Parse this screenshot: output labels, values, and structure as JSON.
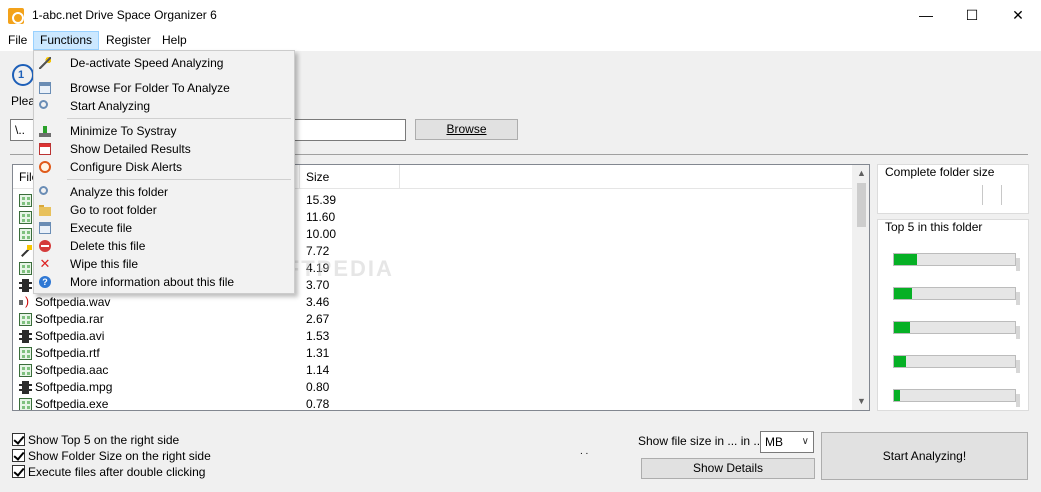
{
  "window": {
    "title": "1-abc.net Drive Space Organizer 6",
    "minimize_glyph": "—",
    "maximize_glyph": "☐",
    "close_glyph": "✕"
  },
  "menubar": {
    "file": "File",
    "functions": "Functions",
    "register": "Register",
    "help": "Help"
  },
  "header": {
    "logo_text": "1",
    "please_text": "Pleas"
  },
  "path": {
    "value": "\\..",
    "browse_label": "Browse"
  },
  "file_list": {
    "columns": [
      "File",
      "Size"
    ],
    "rows": [
      {
        "name": "",
        "size": "15.39",
        "icon": "grid-file-icon"
      },
      {
        "name": "",
        "size": "11.60",
        "icon": "grid-file-icon"
      },
      {
        "name": "",
        "size": "10.00",
        "icon": "grid-file-icon"
      },
      {
        "name": "",
        "size": "7.72",
        "icon": "wand-file-icon"
      },
      {
        "name": "",
        "size": "4.19",
        "icon": "grid-file-icon"
      },
      {
        "name": "",
        "size": "3.70",
        "icon": "film-file-icon"
      },
      {
        "name": "Softpedia.wav",
        "size": "3.46",
        "icon": "sound-file-icon"
      },
      {
        "name": "Softpedia.rar",
        "size": "2.67",
        "icon": "grid-file-icon"
      },
      {
        "name": "Softpedia.avi",
        "size": "1.53",
        "icon": "film-file-icon"
      },
      {
        "name": "Softpedia.rtf",
        "size": "1.31",
        "icon": "grid-file-icon"
      },
      {
        "name": "Softpedia.aac",
        "size": "1.14",
        "icon": "grid-file-icon"
      },
      {
        "name": "Softpedia.mpg",
        "size": "0.80",
        "icon": "film-file-icon"
      },
      {
        "name": "Softpedia.exe",
        "size": "0.78",
        "icon": "grid-file-icon"
      }
    ]
  },
  "side_panel": {
    "complete_folder_size": "Complete folder size",
    "top5_label": "Top 5 in this folder",
    "top5_fill_fractions": [
      0.19,
      0.15,
      0.13,
      0.1,
      0.05
    ]
  },
  "bottom": {
    "checkboxes": [
      {
        "label": "Show Top 5 on the right side",
        "checked": true
      },
      {
        "label": "Show Folder Size on the right side",
        "checked": true
      },
      {
        "label": "Execute files after double clicking",
        "checked": true
      }
    ],
    "size_label": "Show file size in ... in ...",
    "unit_selected": "MB",
    "dots": ". .",
    "show_details": "Show Details",
    "start_analyzing": "Start Analyzing!"
  },
  "functions_menu": {
    "items": [
      {
        "label": "De-activate Speed Analyzing",
        "icon": "wand-icon"
      },
      {
        "label": "Browse For Folder To Analyze",
        "icon": "window-icon"
      },
      {
        "label": "Start Analyzing",
        "icon": "magnifier-icon"
      },
      {
        "label": "Minimize To Systray",
        "icon": "tray-icon"
      },
      {
        "label": "Show Detailed Results",
        "icon": "calendar-icon"
      },
      {
        "label": "Configure Disk Alerts",
        "icon": "alarm-clock-icon"
      },
      {
        "label": "Analyze this folder",
        "icon": "magnifier-icon"
      },
      {
        "label": "Go to root folder",
        "icon": "folder-icon"
      },
      {
        "label": "Execute file",
        "icon": "window-icon"
      },
      {
        "label": "Delete this file",
        "icon": "delete-icon"
      },
      {
        "label": "Wipe this file",
        "icon": "x-icon"
      },
      {
        "label": "More information about this file",
        "icon": "info-icon"
      }
    ]
  },
  "watermark": "SOFTPEDIA",
  "colors": {
    "accent_menu": "#cce8ff",
    "progress_green": "#06b025"
  }
}
